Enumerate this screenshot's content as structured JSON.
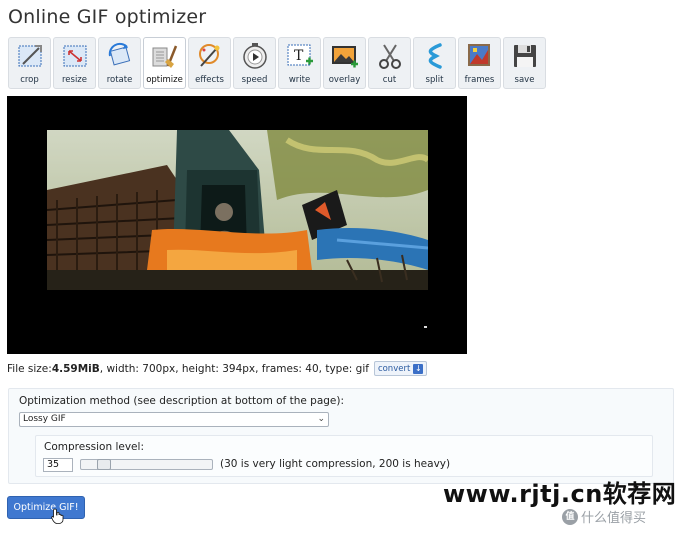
{
  "page": {
    "title": "Online GIF optimizer"
  },
  "toolbar": {
    "tools": [
      {
        "label": "crop",
        "icon": "crop-icon"
      },
      {
        "label": "resize",
        "icon": "resize-icon"
      },
      {
        "label": "rotate",
        "icon": "rotate-icon"
      },
      {
        "label": "optimize",
        "icon": "optimize-icon",
        "active": true
      },
      {
        "label": "effects",
        "icon": "effects-icon"
      },
      {
        "label": "speed",
        "icon": "speed-icon"
      },
      {
        "label": "write",
        "icon": "write-icon"
      },
      {
        "label": "overlay",
        "icon": "overlay-icon"
      },
      {
        "label": "cut",
        "icon": "scissors-icon"
      },
      {
        "label": "split",
        "icon": "split-icon"
      },
      {
        "label": "frames",
        "icon": "frames-icon"
      },
      {
        "label": "save",
        "icon": "floppy-disk-icon"
      }
    ]
  },
  "fileinfo": {
    "size_prefix": "File size: ",
    "size": "4.59MiB",
    "details": ", width: 700px, height: 394px, frames: 40, type: gif",
    "convert_label": "convert"
  },
  "options": {
    "method_label": "Optimization method (see description at bottom of the page):",
    "method_selected": "Lossy GIF",
    "compression_label": "Compression level:",
    "compression_value": "35",
    "compression_fraction": 0.14,
    "compression_hint": "(30 is very light compression, 200 is heavy)"
  },
  "submit": {
    "label": "Optimize GIF!"
  },
  "watermark": {
    "site": "www.rjtj.cn软荐网",
    "brand_badge": "值",
    "brand": "什么值得买"
  },
  "colors": {
    "accent": "#3f78d0",
    "panel_bg": "#f7fafc",
    "preview_bg": "#000000"
  }
}
